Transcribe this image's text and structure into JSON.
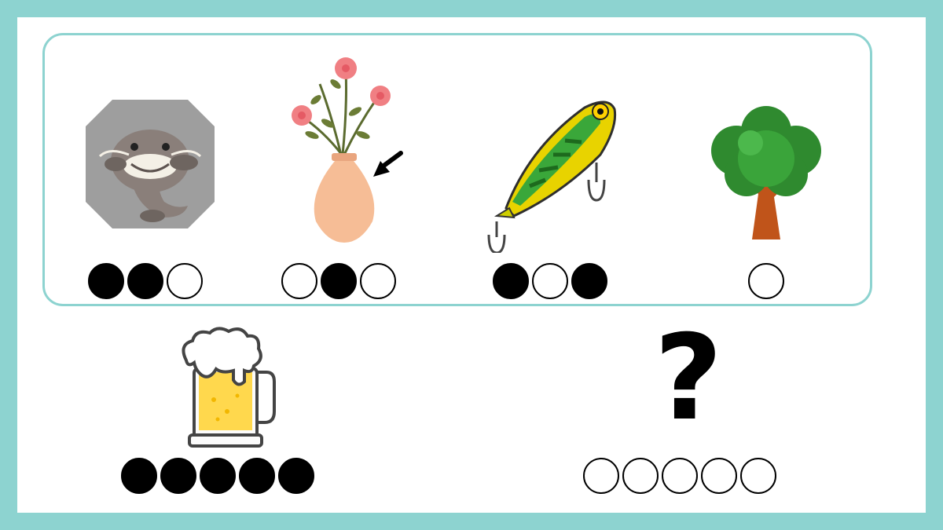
{
  "puzzle": {
    "hints": [
      {
        "icon": "catfish-icon",
        "pattern": [
          1,
          1,
          0
        ]
      },
      {
        "icon": "vase-with-flowers-icon",
        "pattern": [
          0,
          1,
          0
        ]
      },
      {
        "icon": "fishing-lure-icon",
        "pattern": [
          1,
          0,
          1
        ]
      },
      {
        "icon": "tree-icon",
        "pattern": [
          0
        ]
      }
    ],
    "example": {
      "icon": "beer-mug-icon",
      "pattern": [
        1,
        1,
        1,
        1,
        1
      ]
    },
    "answer": {
      "symbol": "?",
      "pattern": [
        0,
        0,
        0,
        0,
        0
      ]
    }
  },
  "colors": {
    "border": "#8dd3d0",
    "filled_dot": "#000000",
    "empty_dot": "#ffffff"
  }
}
